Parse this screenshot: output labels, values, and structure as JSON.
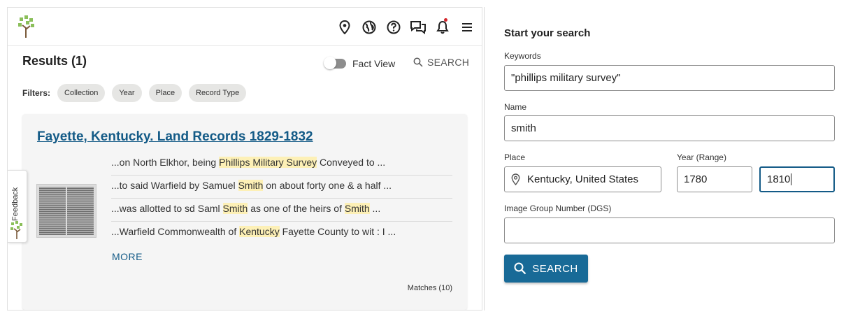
{
  "header": {
    "icons": [
      "location-pin-icon",
      "globe-icon",
      "help-icon",
      "chat-icon",
      "bell-icon",
      "menu-icon"
    ]
  },
  "results": {
    "title": "Results (1)",
    "fact_view_label": "Fact View",
    "search_label": "SEARCH",
    "filters_label": "Filters:",
    "filters": [
      "Collection",
      "Year",
      "Place",
      "Record Type"
    ]
  },
  "card": {
    "title": "Fayette, Kentucky. Land Records 1829-1832",
    "snippets": [
      {
        "pre": "...on North Elkhor, being ",
        "hl1": "Phillips Military Survey",
        "mid": " Conveyed to ...",
        "hl2": "",
        "post": ""
      },
      {
        "pre": "...to said Warfield by Samuel ",
        "hl1": "Smith",
        "mid": " on about forty one & a half ...",
        "hl2": "",
        "post": ""
      },
      {
        "pre": "...was allotted to sd Saml ",
        "hl1": "Smith",
        "mid": " as one of the heirs of ",
        "hl2": "Smith",
        "post": " ..."
      },
      {
        "pre": "...Warfield Commonwealth of ",
        "hl1": "Kentucky",
        "mid": " Fayette County to wit : I ...",
        "hl2": "",
        "post": ""
      }
    ],
    "more_label": "MORE",
    "matches_label": "Matches (10)"
  },
  "feedback": {
    "label": "Feedback"
  },
  "search_form": {
    "title": "Start your search",
    "keywords_label": "Keywords",
    "keywords_value": "\"phillips military survey\"",
    "name_label": "Name",
    "name_value": "smith",
    "place_label": "Place",
    "place_value": "Kentucky, United States",
    "year_label": "Year (Range)",
    "year_from": "1780",
    "year_to": "1810",
    "dgs_label": "Image Group Number (DGS)",
    "dgs_value": "",
    "search_button": "SEARCH"
  },
  "colors": {
    "accent": "#145b87",
    "button": "#186a97",
    "highlight": "#fdf0b6",
    "notification": "#d3262c"
  }
}
